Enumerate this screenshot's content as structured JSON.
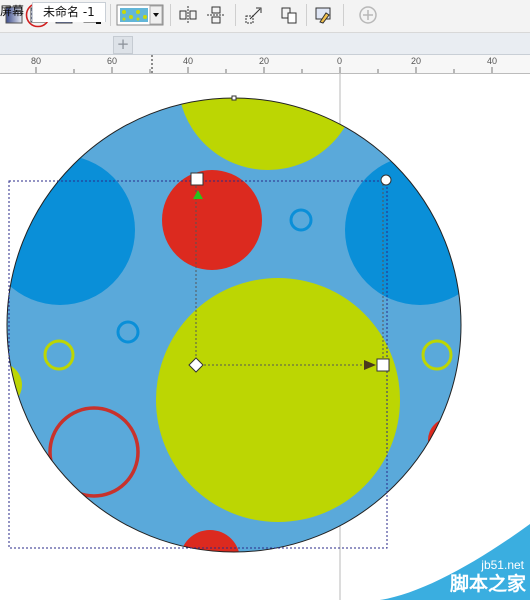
{
  "toolbar": {
    "items": [
      {
        "name": "fill-square-icon"
      },
      {
        "name": "pattern-fill-icon",
        "highlighted": true
      },
      {
        "name": "texture-fill-icon"
      },
      {
        "name": "postscript-fill-icon"
      },
      {
        "name": "pattern-swatch-dropdown"
      },
      {
        "name": "align-horizontal-icon"
      },
      {
        "name": "align-vertical-icon"
      },
      {
        "name": "transform-icon"
      },
      {
        "name": "mirror-icon"
      },
      {
        "name": "edit-fill-icon"
      },
      {
        "name": "add-icon"
      }
    ],
    "highlight_color": "#d11f1f"
  },
  "tabs": {
    "screen_label": "屏幕",
    "doc_label": "未命名 -1",
    "add_label": "+"
  },
  "ruler": {
    "labels": [
      "80",
      "60",
      "40",
      "20",
      "0",
      "20",
      "40"
    ]
  },
  "colors": {
    "circle_bg": "#5aa9da",
    "dark_blue": "#0a8fd8",
    "lime": "#bcd603",
    "red": "#dc2a1f",
    "outline_red": "#c8322c"
  },
  "watermark": {
    "url": "jb51.net",
    "text": "脚本之家"
  }
}
